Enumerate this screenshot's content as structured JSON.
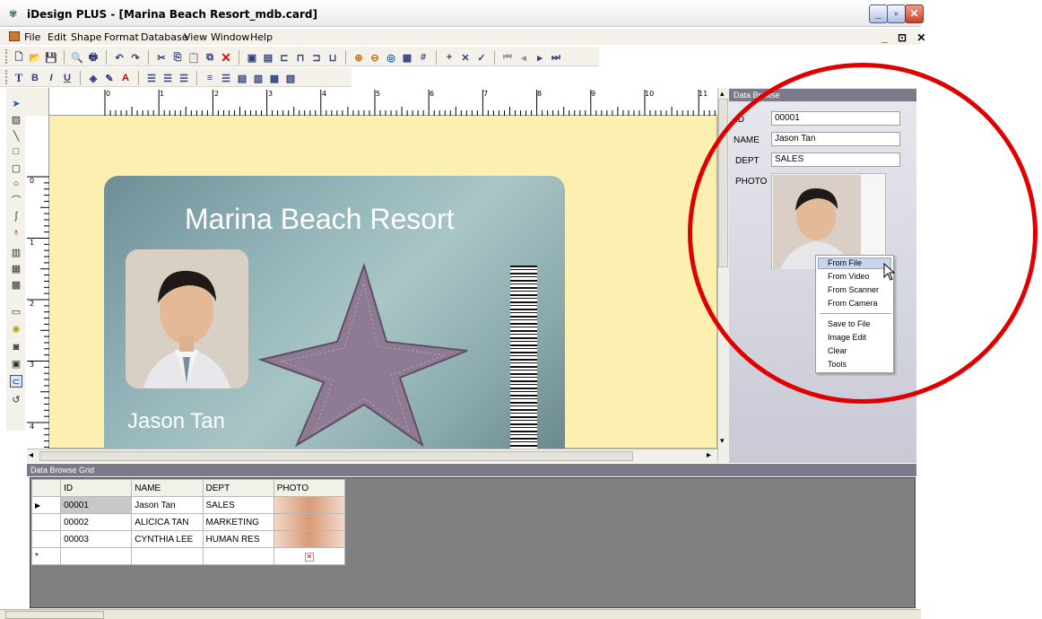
{
  "window": {
    "title": "iDesign PLUS - [Marina Beach Resort_mdb.card]",
    "controls": {
      "minimize": "_",
      "maximize": "▫",
      "close": "✕"
    },
    "mdi_controls": "_ ⊡ ✕"
  },
  "menu": [
    "File",
    "Edit",
    "Shape",
    "Format",
    "Database",
    "View",
    "Window",
    "Help"
  ],
  "format_toolbar": {
    "bold": "B",
    "italic": "I",
    "underline": "U",
    "tt": "T",
    "text_color": "A"
  },
  "ruler": {
    "top": [
      "0",
      "1",
      "2",
      "3",
      "4",
      "5",
      "6",
      "7",
      "8",
      "9",
      "10",
      "11"
    ],
    "left": [
      "0",
      "1",
      "2",
      "3",
      "4"
    ]
  },
  "card": {
    "title": "Marina Beach Resort",
    "name": "Jason Tan"
  },
  "data_browse": {
    "header": "Data Browse",
    "fields": [
      {
        "label": "ID",
        "value": "00001"
      },
      {
        "label": "NAME",
        "value": "Jason Tan"
      },
      {
        "label": "DEPT",
        "value": "SALES"
      }
    ],
    "photo_label": "PHOTO",
    "context_menu": [
      "From File",
      "From Video",
      "From Scanner",
      "From Camera",
      "Save to File",
      "Image Edit",
      "Clear",
      "Tools"
    ]
  },
  "grid": {
    "title": "Data Browse Grid",
    "columns": [
      "ID",
      "NAME",
      "DEPT",
      "PHOTO"
    ],
    "rows": [
      {
        "ID": "00001",
        "NAME": "Jason Tan",
        "DEPT": "SALES"
      },
      {
        "ID": "00002",
        "NAME": "ALICICA TAN",
        "DEPT": "MARKETING"
      },
      {
        "ID": "00003",
        "NAME": "CYNTHIA LEE",
        "DEPT": "HUMAN RES"
      }
    ],
    "current_row_marker": "▶",
    "new_row_marker": "*"
  },
  "colors": {
    "accent_red": "#e00000",
    "grid_bg": "#808080",
    "designer_bg": "#fcf0b0"
  }
}
